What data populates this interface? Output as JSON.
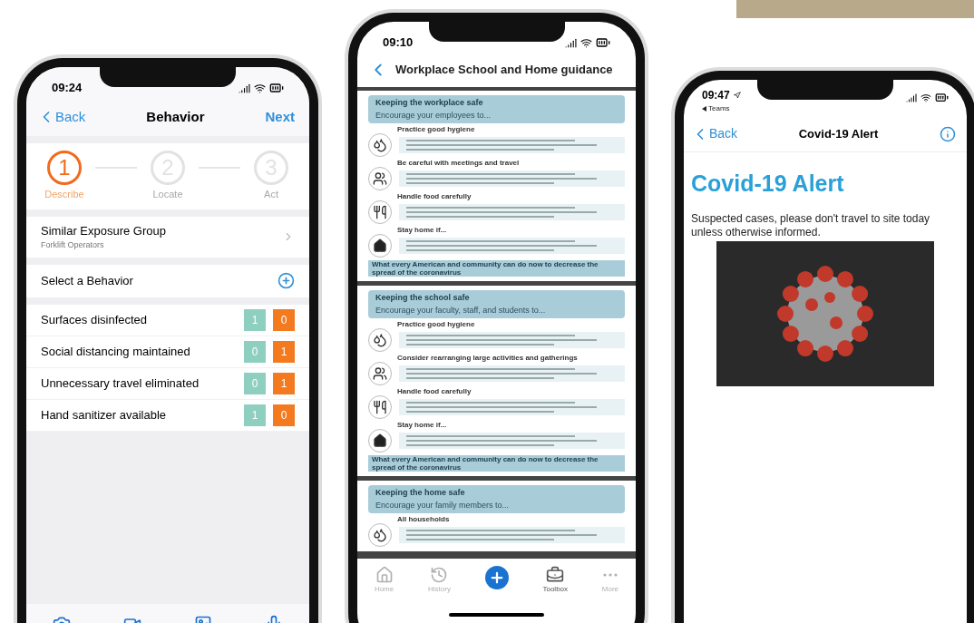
{
  "behavior_screen": {
    "time": "09:24",
    "nav": {
      "back": "Back",
      "title": "Behavior",
      "next": "Next"
    },
    "steps": [
      {
        "number": "1",
        "label": "Describe",
        "selected": true
      },
      {
        "number": "2",
        "label": "Locate",
        "selected": false
      },
      {
        "number": "3",
        "label": "Act",
        "selected": false
      }
    ],
    "exposure_group": {
      "title": "Similar Exposure Group",
      "subtitle": "Forklift Operators"
    },
    "select_row": {
      "label": "Select a Behavior"
    },
    "behaviors": [
      {
        "name": "Surfaces disinfected",
        "positive": "1",
        "negative": "0"
      },
      {
        "name": "Social distancing maintained",
        "positive": "0",
        "negative": "1"
      },
      {
        "name": "Unnecessary travel eliminated",
        "positive": "0",
        "negative": "1"
      },
      {
        "name": "Hand sanitizer available",
        "positive": "1",
        "negative": "0"
      }
    ]
  },
  "guidance_screen": {
    "time": "09:10",
    "title": "Workplace School and Home guidance",
    "sections": [
      {
        "title": "Keeping the workplace safe",
        "subtitle": "Encourage your employees to...",
        "topics": [
          {
            "heading": "Practice good hygiene",
            "kind": "hygiene"
          },
          {
            "heading": "Be careful with meetings and travel",
            "kind": "meeting"
          },
          {
            "heading": "Handle food carefully",
            "kind": "food"
          },
          {
            "heading": "Stay home if...",
            "kind": "home"
          }
        ],
        "footer": "What every American and community can do now to decrease the spread of the coronavirus"
      },
      {
        "title": "Keeping the school safe",
        "subtitle": "Encourage your faculty, staff, and students to...",
        "topics": [
          {
            "heading": "Practice good hygiene",
            "kind": "hygiene"
          },
          {
            "heading": "Consider rearranging large activities and gatherings",
            "kind": "meeting"
          },
          {
            "heading": "Handle food carefully",
            "kind": "food"
          },
          {
            "heading": "Stay home if...",
            "kind": "home"
          }
        ],
        "footer": "What every American and community can do now to decrease the spread of the coronavirus"
      },
      {
        "title": "Keeping the home safe",
        "subtitle": "Encourage your family members to...",
        "topics": [
          {
            "heading": "All households",
            "kind": "hygiene"
          }
        ]
      }
    ],
    "tabs": [
      {
        "label": "Home",
        "kind": "home",
        "selected": false
      },
      {
        "label": "History",
        "kind": "history",
        "selected": false
      },
      {
        "kind": "add",
        "selected": false
      },
      {
        "label": "Toolbox",
        "kind": "toolbox",
        "selected": true
      },
      {
        "label": "More",
        "kind": "more",
        "selected": false
      }
    ]
  },
  "alert_screen": {
    "time": "09:47",
    "source": "Teams",
    "nav": {
      "back": "Back",
      "title": "Covid-19 Alert"
    },
    "heading": "Covid-19 Alert",
    "message": "Suspected cases, please don't travel to site today unless otherwise informed."
  }
}
